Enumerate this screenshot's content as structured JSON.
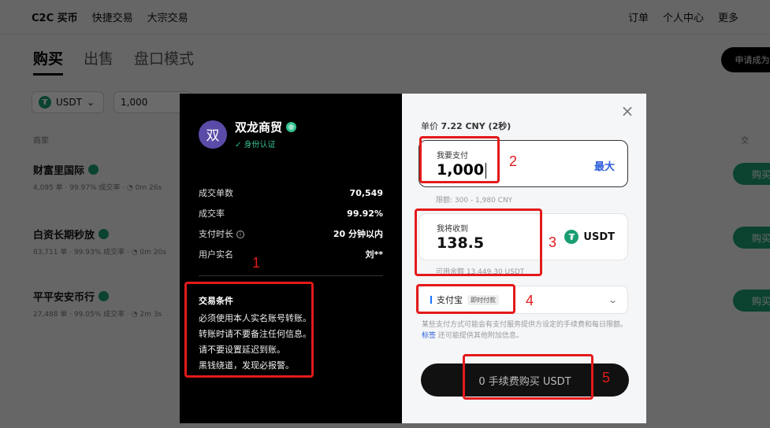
{
  "background": {
    "nav_left": [
      "C2C 买币",
      "快捷交易",
      "大宗交易"
    ],
    "nav_right": [
      "订单",
      "个人中心",
      "更多"
    ],
    "tabs": [
      "购买",
      "出售",
      "盘口模式"
    ],
    "apply_label": "申请成为商",
    "filter_coin": "USDT",
    "filter_amount": "1,000",
    "col_merchant": "商家",
    "col_right": "交",
    "merchants": [
      {
        "name": "财富里国际",
        "meta": "4,095 单 · 99.97% 成交率 · ◔ 0m 26s",
        "buy": "购买"
      },
      {
        "name": "白资长期秒放",
        "meta": "83,711 单 · 99.93% 成交率 · ◔ 0m 20s",
        "buy": "购买"
      },
      {
        "name": "平平安安币行",
        "meta": "27,488 单 · 99.05% 成交率 · ◔ 2m 3s",
        "buy": "购买"
      }
    ]
  },
  "seller": {
    "avatar": "双",
    "name": "双龙商贸",
    "verified": "✓ 身份认证",
    "stats": [
      {
        "label": "成交单数",
        "value": "70,549"
      },
      {
        "label": "成交率",
        "value": "99.92%"
      },
      {
        "label": "支付时长",
        "value": "20 分钟以内"
      },
      {
        "label": "用户实名",
        "value": "刘**"
      }
    ],
    "terms_title": "交易条件",
    "terms": [
      "必须使用本人实名账号转账。",
      "转账时请不要备注任何信息。",
      "请不要设置延迟到账。",
      "黑钱绕道，发现必报警。"
    ]
  },
  "order": {
    "price_label": "单价",
    "price_value": "7.22 CNY (2秒)",
    "pay_label": "我要支付",
    "pay_value": "1,000",
    "max_label": "最大",
    "limit": "限额: 300 - 1,980 CNY",
    "receive_label": "我将收到",
    "receive_value": "138.5",
    "receive_currency": "USDT",
    "balance": "可用余额 13,449.30 USDT",
    "method": "支付宝",
    "method_tag": "即时付款",
    "note_pre": "某些支付方式可能会有支付服务提供方设定的手续费和每日限额。",
    "note_link": "标签",
    "note_post": " 还可能提供其他附加信息。",
    "submit": "0 手续费购买 USDT",
    "close": "×"
  },
  "annotations": [
    "1",
    "2",
    "3",
    "4",
    "5"
  ],
  "colors": {
    "annotation": "#e31a1a",
    "accent_green": "#1a9d73",
    "link_blue": "#2d5fdc"
  }
}
